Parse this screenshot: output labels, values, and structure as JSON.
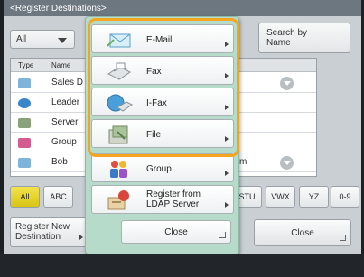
{
  "header": {
    "title": "<Register Destinations>"
  },
  "toolbar": {
    "dropdown_value": "All",
    "search_label_1": "Search by",
    "search_label_2": "Name"
  },
  "list": {
    "columns": [
      "Type",
      "Name"
    ],
    "rows": [
      {
        "name": "Sales D",
        "icon": "address-book-icon",
        "tail": ""
      },
      {
        "name": "Leader",
        "icon": "leader-icon",
        "tail": ""
      },
      {
        "name": "Server",
        "icon": "server-icon",
        "tail": ""
      },
      {
        "name": "Group",
        "icon": "group-icon",
        "tail": ""
      },
      {
        "name": "Bob",
        "icon": "address-book-icon",
        "tail": "m"
      }
    ]
  },
  "filters": [
    "All",
    "ABC",
    "STU",
    "VWX",
    "YZ",
    "0-9"
  ],
  "bottom": {
    "register_line1": "Register New",
    "register_line2": "Destination",
    "close": "Close"
  },
  "popup": {
    "items": [
      {
        "label": "E-Mail",
        "icon": "email-icon"
      },
      {
        "label": "Fax",
        "icon": "fax-icon"
      },
      {
        "label": "I-Fax",
        "icon": "ifax-icon"
      },
      {
        "label": "File",
        "icon": "file-icon"
      },
      {
        "label": "Group",
        "icon": "group-icon"
      },
      {
        "label_line1": "Register from",
        "label_line2": "LDAP Server",
        "icon": "ldap-server-icon"
      }
    ],
    "close": "Close"
  },
  "colors": {
    "highlight": "#f3a520",
    "popup_bg": "#b6dbcb",
    "active_filter": "#e9d82c"
  }
}
